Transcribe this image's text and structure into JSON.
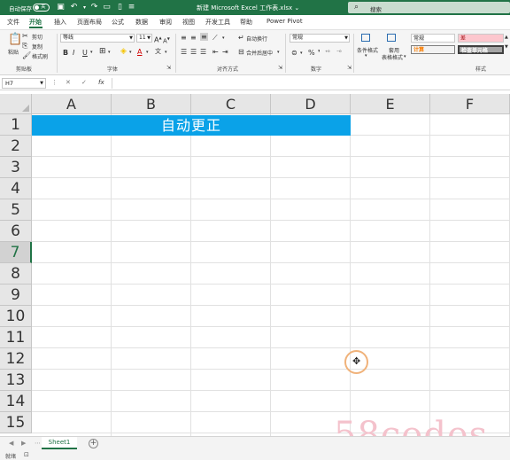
{
  "titlebar": {
    "autosave_label": "自动保存",
    "autosave_state": "关",
    "doc_title": "新建 Microsoft Excel 工作表.xlsx",
    "title_dropdown": "⌄",
    "search_placeholder": "搜索",
    "accent_color": "#217346"
  },
  "tabs": [
    "文件",
    "开始",
    "插入",
    "页面布局",
    "公式",
    "数据",
    "审阅",
    "视图",
    "开发工具",
    "帮助",
    "Power Pivot"
  ],
  "active_tab": "开始",
  "ribbon": {
    "clipboard": {
      "paste": "粘贴",
      "cut": "剪切",
      "copy": "复制",
      "format_painter": "格式刷",
      "group_label": "剪贴板"
    },
    "font": {
      "font_name": "等线",
      "font_size": "11",
      "bold": "B",
      "italic": "I",
      "underline": "U",
      "grow": "A",
      "shrink": "A",
      "wen": "文",
      "font_color": "A",
      "group_label": "字体"
    },
    "alignment": {
      "wrap_text": "自动换行",
      "merge_center": "合并后居中",
      "group_label": "对齐方式"
    },
    "number": {
      "format": "常规",
      "group_label": "数字"
    },
    "styles": {
      "conditional": "条件格式",
      "table_format_1": "套用",
      "table_format_2": "表格格式",
      "normal": "常规",
      "bad": "差",
      "calculation": "计算",
      "check_cell": "检查单元格",
      "group_label": "样式"
    }
  },
  "formula_bar": {
    "name_box": "H7",
    "cancel": "✕",
    "enter": "✓",
    "fx": "fx",
    "content": ""
  },
  "grid": {
    "columns": [
      "A",
      "B",
      "C",
      "D",
      "E",
      "F"
    ],
    "rows": [
      "1",
      "2",
      "3",
      "4",
      "5",
      "6",
      "7",
      "8",
      "9",
      "10",
      "11",
      "12",
      "13",
      "14",
      "15"
    ],
    "selected_row": "7",
    "merged_cell_text": "自动更正",
    "merged_cell_color": "#0aa2e8"
  },
  "sheets": {
    "tabs": [
      "Sheet1"
    ],
    "add_symbol": "+"
  },
  "status": {
    "ready": "就绪"
  },
  "watermark": "58codes"
}
